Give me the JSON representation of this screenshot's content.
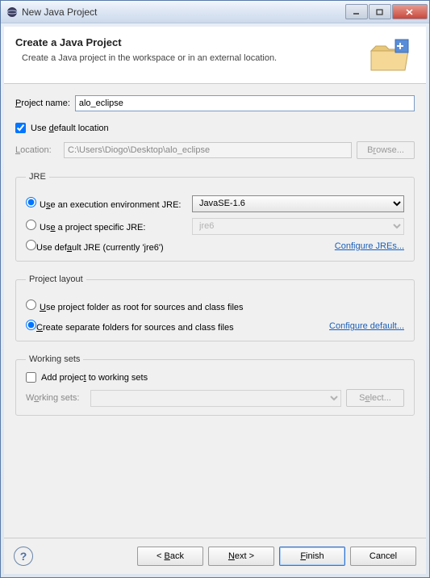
{
  "titlebar": {
    "title": "New Java Project"
  },
  "header": {
    "title": "Create a Java Project",
    "description": "Create a Java project in the workspace or in an external location."
  },
  "project": {
    "name_label": "Project name:",
    "name_value": "alo_eclipse"
  },
  "location": {
    "use_default_label": "Use default location",
    "use_default_checked": true,
    "label": "Location:",
    "value": "C:\\Users\\Diogo\\Desktop\\alo_eclipse",
    "browse_label": "Browse..."
  },
  "jre": {
    "legend": "JRE",
    "exec_env_label": "Use an execution environment JRE:",
    "exec_env_value": "JavaSE-1.6",
    "project_specific_label": "Use a project specific JRE:",
    "project_specific_value": "jre6",
    "default_label": "Use default JRE (currently 'jre6')",
    "configure_link": "Configure JREs...",
    "selected": "exec_env"
  },
  "layout": {
    "legend": "Project layout",
    "root_label": "Use project folder as root for sources and class files",
    "separate_label": "Create separate folders for sources and class files",
    "configure_link": "Configure default...",
    "selected": "separate"
  },
  "workingsets": {
    "legend": "Working sets",
    "add_label": "Add project to working sets",
    "add_checked": false,
    "label": "Working sets:",
    "value": "",
    "select_label": "Select..."
  },
  "footer": {
    "back_label": "< Back",
    "next_label": "Next >",
    "finish_label": "Finish",
    "cancel_label": "Cancel"
  }
}
